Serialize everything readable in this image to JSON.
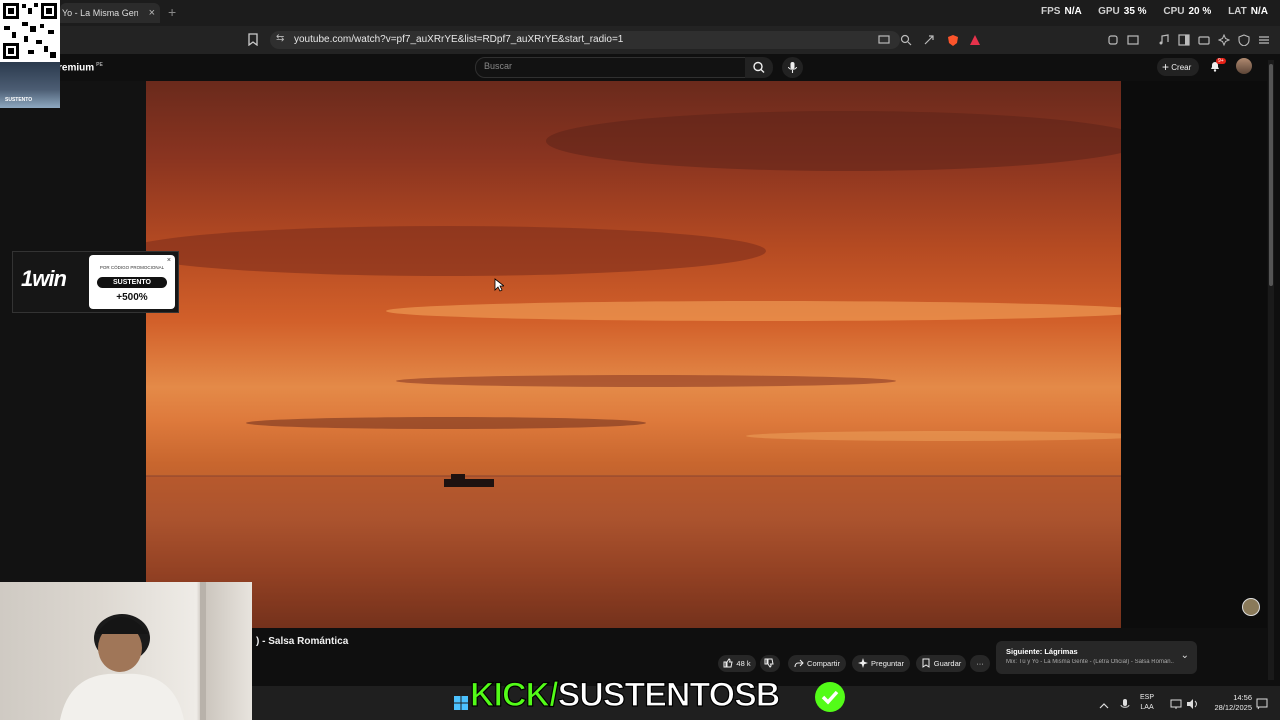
{
  "browser": {
    "tab_title": "Yo - La Misma Gente",
    "tab_close": "×",
    "new_tab": "+",
    "url": "youtube.com/watch?v=pf7_auXRrYE&list=RDpf7_auXRrYE&start_radio=1",
    "url_icon": "⇆"
  },
  "perf": {
    "fps_label": "FPS",
    "fps_value": "N/A",
    "gpu_label": "GPU",
    "gpu_value": "35 %",
    "cpu_label": "CPU",
    "cpu_value": "20 %",
    "lat_label": "LAT",
    "lat_value": "N/A"
  },
  "youtube": {
    "brand": "remium",
    "brand_sup": "PE",
    "search_placeholder": "Buscar",
    "create_label": "Crear",
    "create_plus": "+",
    "notifications": "9+",
    "video_title": ") - Salsa Romántica",
    "likes": "48 k",
    "share_label": "Compartir",
    "ask_label": "Preguntar",
    "save_label": "Guardar",
    "more_label": "···",
    "next_up_title": "Siguiente: Lágrimas",
    "next_up_subtitle": "Mix: Tú y Yo - La Misma Gente - (Letra Oficial) - Salsa Román...",
    "next_up_chevron": "⌄"
  },
  "overlays": {
    "qr_thumb_label": "SUSTENTO",
    "ad_logo": "1win",
    "ad_promo_label": "POR CÓDIGO PROMOCIONAL",
    "ad_code": "SUSTENTO",
    "ad_bonus": "+500%",
    "ad_close": "×"
  },
  "stream": {
    "kick_prefix": "KICK/",
    "kick_name": "SUSTENTOSB"
  },
  "taskbar": {
    "lang_top": "ESP",
    "lang_bottom": "LAA",
    "time": "14:56",
    "date": "28/12/2025"
  },
  "colors": {
    "kick_green": "#53fc18",
    "notif_red": "#e62117",
    "page_bg": "#0f0f0f"
  }
}
